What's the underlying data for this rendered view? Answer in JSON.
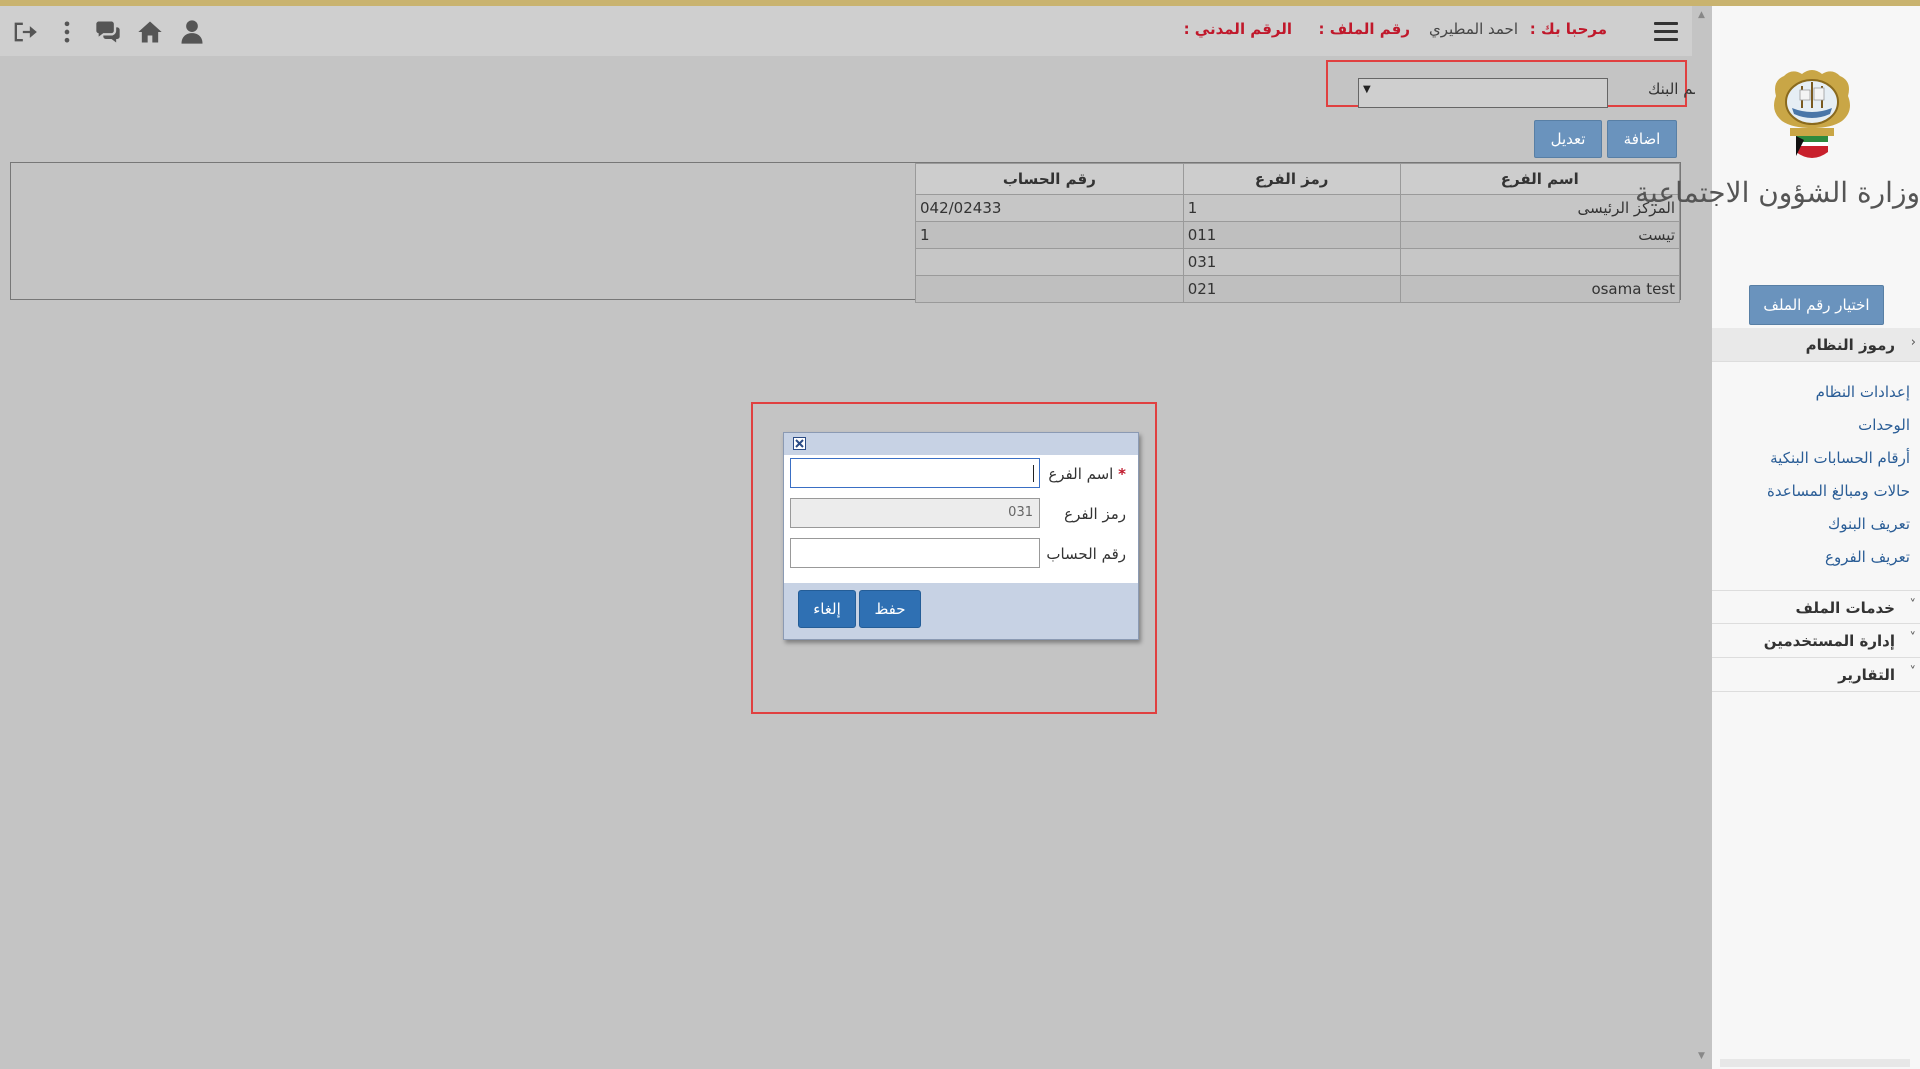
{
  "header": {
    "welcome_label": "مرحبا بك :",
    "user_name": "احمد المطيري",
    "file_no_label": "رقم الملف :",
    "civil_id_label": "الرقم المدني :",
    "icons": [
      "menu-icon",
      "user-icon",
      "home-icon",
      "comments-icon",
      "more-vertical-icon",
      "logout-icon"
    ]
  },
  "bank": {
    "label": "اسم البنك",
    "selected": ""
  },
  "toolbar": {
    "add_label": "اضافة",
    "edit_label": "تعديل"
  },
  "grid": {
    "columns": [
      "اسم الفرع",
      "رمز الفرع",
      "رقم الحساب"
    ],
    "rows": [
      {
        "name": "المركز الرئيسى",
        "code": "1",
        "account": "042/02433"
      },
      {
        "name": "تيست",
        "code": "011",
        "account": "1"
      },
      {
        "name": "",
        "code": "031",
        "account": ""
      },
      {
        "name": "osama test",
        "code": "021",
        "account": ""
      }
    ]
  },
  "dialog": {
    "required_mark": "*",
    "branch_name_label": "اسم الفرع",
    "branch_name_value": "",
    "branch_code_label": "رمز الفرع",
    "branch_code_value": "031",
    "account_label": "رقم الحساب",
    "account_value": "",
    "save_label": "حفظ",
    "cancel_label": "إلغاء"
  },
  "sidebar": {
    "ministry_name": "وزارة الشؤون الاجتماعية",
    "select_file_label": "اختيار رقم الملف",
    "sections": [
      {
        "label": "رموز النظام",
        "expanded": true,
        "items": [
          "إعدادات النظام",
          "الوحدات",
          "أرقام الحسابات البنكية",
          "حالات ومبالغ المساعدة",
          "تعريف البنوك",
          "تعريف الفروع"
        ]
      },
      {
        "label": "خدمات الملف",
        "expanded": false
      },
      {
        "label": "إدارة المستخدمين",
        "expanded": false
      },
      {
        "label": "التقارير",
        "expanded": false
      }
    ]
  },
  "colors": {
    "accent_red": "#c0182b",
    "button_blue": "#6a93bd",
    "dialog_button_blue": "#2f70b3",
    "top_strip": "#c9b36f"
  }
}
